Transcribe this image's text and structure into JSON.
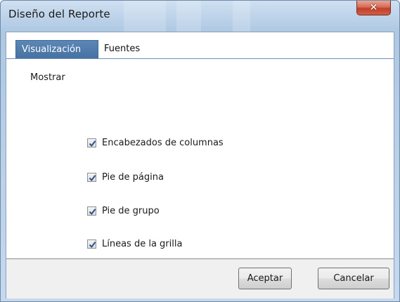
{
  "window": {
    "title": "Diseño del Reporte",
    "close_glyph": "✕"
  },
  "tabs": [
    {
      "label": "Visualización",
      "active": true
    },
    {
      "label": "Fuentes",
      "active": false
    }
  ],
  "panel": {
    "group_label": "Mostrar",
    "options": [
      {
        "label": "Encabezados de columnas",
        "checked": true
      },
      {
        "label": "Pie de página",
        "checked": true
      },
      {
        "label": "Pie de grupo",
        "checked": true
      },
      {
        "label": "Líneas de la grilla",
        "checked": true
      }
    ]
  },
  "footer": {
    "ok_label": "Aceptar",
    "cancel_label": "Cancelar"
  },
  "colors": {
    "active_tab": "#4a77a8",
    "checkmark": "#2a4f8f"
  },
  "icons": {
    "close": "close-icon",
    "checkbox": "checkmark-icon"
  }
}
